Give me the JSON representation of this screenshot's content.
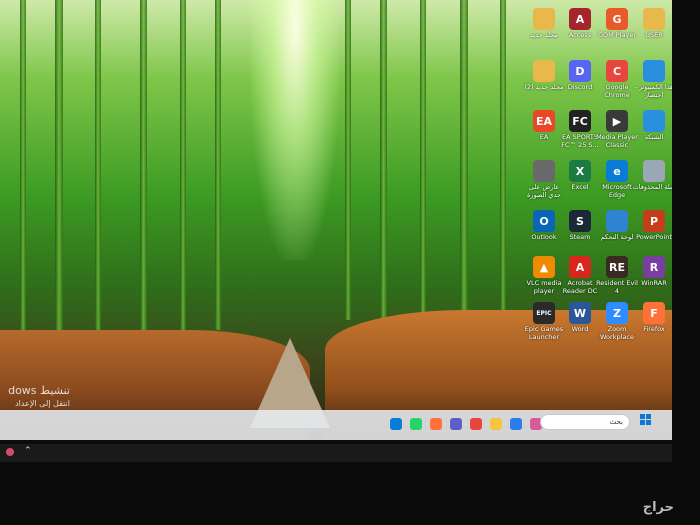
{
  "watermark": "حراج",
  "activation": {
    "line1": "dows تنشيط",
    "line2": "انتقل إلى الإعداد"
  },
  "taskbar": {
    "search_label": "بحث",
    "pinned": [
      {
        "name": "edge-icon",
        "color": "#0b7bd8"
      },
      {
        "name": "whatsapp-icon",
        "color": "#25d366"
      },
      {
        "name": "firefox-icon",
        "color": "#ff7139"
      },
      {
        "name": "teams-icon",
        "color": "#5b5fc7"
      },
      {
        "name": "chrome-icon",
        "color": "#e8453c"
      },
      {
        "name": "file-explorer-icon",
        "color": "#f5c542"
      },
      {
        "name": "store-icon",
        "color": "#2b7de9"
      },
      {
        "name": "copilot-icon",
        "color": "#d95a9a"
      },
      {
        "name": "game-icon",
        "color": "#555555"
      }
    ]
  },
  "desktop_icons": [
    {
      "label": "مجلد جديد",
      "glyph": "",
      "color": "#e8b84a",
      "name": "new-folder-icon"
    },
    {
      "label": "Access",
      "glyph": "A",
      "color": "#a4262c",
      "name": "access-icon"
    },
    {
      "label": "GOM Player",
      "glyph": "G",
      "color": "#e85a2a",
      "name": "gom-player-icon"
    },
    {
      "label": "USER",
      "glyph": "",
      "color": "#e8b84a",
      "name": "user-folder-icon"
    },
    {
      "label": "مجلد جديد (2)",
      "glyph": "",
      "color": "#e8b84a",
      "name": "new-folder-2-icon"
    },
    {
      "label": "Discord",
      "glyph": "D",
      "color": "#5865f2",
      "name": "discord-icon"
    },
    {
      "label": "Google Chrome",
      "glyph": "C",
      "color": "#e8453c",
      "name": "chrome-desktop-icon"
    },
    {
      "label": "هذا الكمبيوتر - اختصار",
      "glyph": "",
      "color": "#2b8fe0",
      "name": "this-pc-icon"
    },
    {
      "label": "EA",
      "glyph": "EA",
      "color": "#e9472a",
      "name": "ea-icon"
    },
    {
      "label": "EA SPORTS FC™ 25 S...",
      "glyph": "FC",
      "color": "#222222",
      "name": "ea-fc-icon"
    },
    {
      "label": "Media Player Classic",
      "glyph": "▶",
      "color": "#3a3a3a",
      "name": "media-player-classic-icon"
    },
    {
      "label": "الشبكة",
      "glyph": "",
      "color": "#2b8fe0",
      "name": "network-icon"
    },
    {
      "label": "عارض على حدي الصورة",
      "glyph": "",
      "color": "#6a6a6a",
      "name": "image-viewer-icon"
    },
    {
      "label": "Excel",
      "glyph": "X",
      "color": "#1d7a43",
      "name": "excel-icon"
    },
    {
      "label": "Microsoft Edge",
      "glyph": "e",
      "color": "#0b7bd8",
      "name": "edge-desktop-icon"
    },
    {
      "label": "سلة المحذوفات",
      "glyph": "",
      "color": "#9aa7b4",
      "name": "recycle-bin-icon"
    },
    {
      "label": "Outlook",
      "glyph": "O",
      "color": "#0a64b8",
      "name": "outlook-icon"
    },
    {
      "label": "Steam",
      "glyph": "S",
      "color": "#1b2838",
      "name": "steam-icon"
    },
    {
      "label": "لوحة التحكم",
      "glyph": "",
      "color": "#2f83d1",
      "name": "control-panel-icon"
    },
    {
      "label": "PowerPoint",
      "glyph": "P",
      "color": "#c43e1c",
      "name": "powerpoint-icon"
    },
    {
      "label": "VLC media player",
      "glyph": "▲",
      "color": "#f08a00",
      "name": "vlc-icon"
    },
    {
      "label": "Acrobat Reader DC",
      "glyph": "A",
      "color": "#d8261c",
      "name": "acrobat-icon"
    },
    {
      "label": "Resident Evil 4",
      "glyph": "RE",
      "color": "#3a2a22",
      "name": "resident-evil-icon"
    },
    {
      "label": "WinRAR",
      "glyph": "R",
      "color": "#7a3ea0",
      "name": "winrar-icon"
    },
    {
      "label": "Epic Games Launcher",
      "glyph": "EPIC",
      "color": "#2a2a2a",
      "name": "epic-games-icon"
    },
    {
      "label": "Word",
      "glyph": "W",
      "color": "#2b579a",
      "name": "word-icon"
    },
    {
      "label": "Zoom Workplace",
      "glyph": "Z",
      "color": "#2d8cff",
      "name": "zoom-icon"
    },
    {
      "label": "Firefox",
      "glyph": "F",
      "color": "#ff7139",
      "name": "firefox-desktop-icon"
    }
  ]
}
